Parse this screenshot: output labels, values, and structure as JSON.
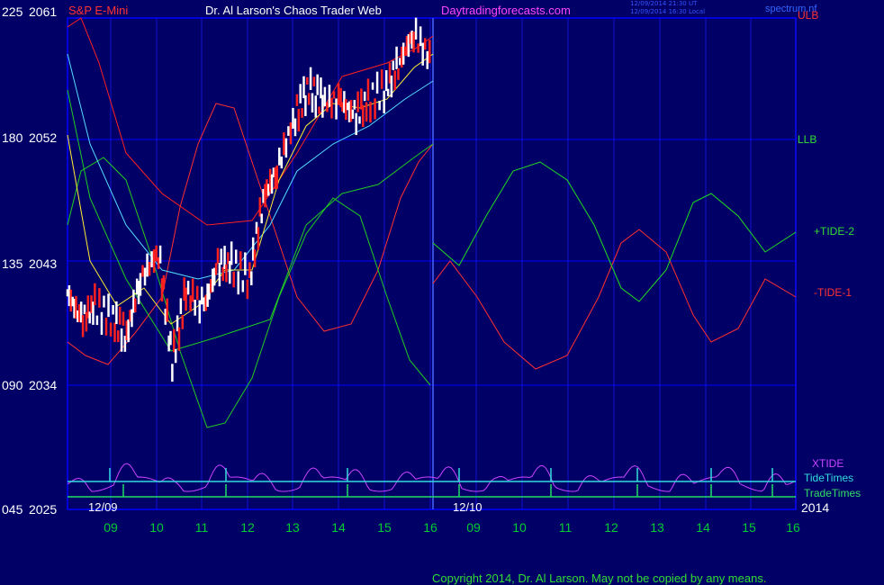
{
  "header": {
    "symbol": "S&P E-Mini",
    "title": "Dr. Al Larson's Chaos Trader Web",
    "site": "Daytradingforecasts.com",
    "timestamp_ut": "12/09/2014 21:30 UT",
    "timestamp_local": "12/09/2014 16:30 Local",
    "spectrum_label": "spectrum.nf"
  },
  "y_axis": {
    "left_ticks": [
      "225",
      "180",
      "135",
      "090",
      "045"
    ],
    "right_ticks": [
      "2061",
      "2052",
      "2043",
      "2034",
      "2025"
    ]
  },
  "right_labels": {
    "ulb": "ULB",
    "llb": "LLB",
    "tide_plus": "+TIDE-2",
    "tide_minus": "-TIDE-1",
    "xtide": "XTIDE",
    "tide_times": "TideTimes",
    "trade_times": "TradeTimes",
    "year": "2014"
  },
  "dates": {
    "d1": "12/09",
    "d2": "12/10"
  },
  "x_ticks": [
    "09",
    "10",
    "11",
    "12",
    "13",
    "14",
    "15",
    "16",
    "09",
    "10",
    "11",
    "12",
    "13",
    "14",
    "15",
    "16"
  ],
  "copyright": "Copyright 2014, Dr. Al Larson. May not be copied by any means.",
  "colors": {
    "background": "#000066",
    "grid": "#0000ff",
    "ulb_line": "#ff2020",
    "llb_line": "#22cc22",
    "tide_plus": "#22dd22",
    "tide_minus": "#ff3030",
    "cyan_avg": "#55ddff",
    "yellow_avg": "#ffee33",
    "xtide": "#cc44ff",
    "tide_times": "#33dddd",
    "trade_times": "#22dd66"
  },
  "chart_data": {
    "type": "line",
    "title": "S&P E-Mini",
    "y_price_range": [
      2025,
      2061
    ],
    "y_index_range": [
      45,
      225
    ],
    "x_categories": [
      "09",
      "10",
      "11",
      "12",
      "13",
      "14",
      "15",
      "16",
      "09",
      "10",
      "11",
      "12",
      "13",
      "14",
      "15",
      "16"
    ],
    "series": [
      {
        "name": "ULB"
      },
      {
        "name": "LLB"
      },
      {
        "name": "+TIDE-2"
      },
      {
        "name": "-TIDE-1"
      },
      {
        "name": "XTIDE"
      },
      {
        "name": "TideTimes"
      },
      {
        "name": "TradeTimes"
      }
    ],
    "price_approx": {
      "hours": [
        8.0,
        8.3,
        8.6,
        9.0,
        9.3,
        9.6,
        10.0,
        10.3,
        10.6,
        11.0,
        11.3,
        11.6,
        12.0,
        12.3,
        12.6,
        13.0,
        13.3,
        13.6,
        14.0,
        14.3,
        14.6,
        15.0,
        15.3,
        15.6,
        16.0
      ],
      "values": [
        2041,
        2039,
        2040,
        2039,
        2038,
        2042,
        2044,
        2036,
        2041,
        2040,
        2043,
        2043,
        2042,
        2048,
        2050,
        2054,
        2056,
        2055,
        2055,
        2054,
        2055,
        2056,
        2058,
        2060,
        2058
      ]
    }
  }
}
